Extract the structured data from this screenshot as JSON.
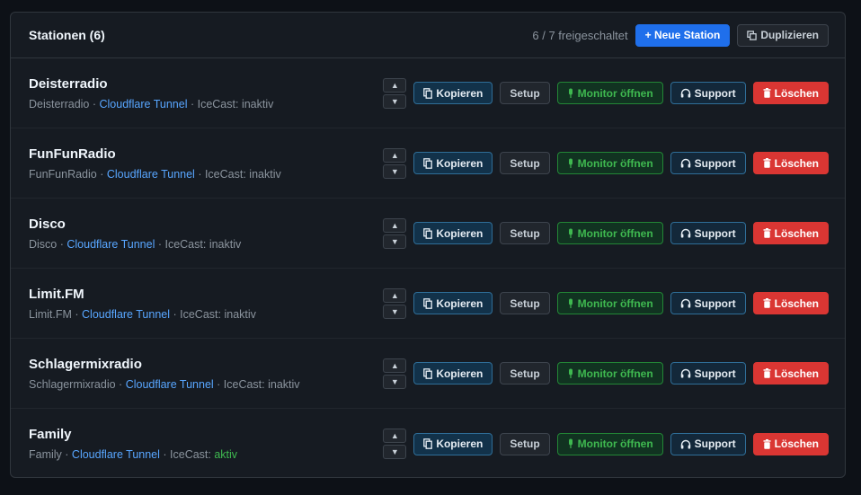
{
  "header": {
    "title": "Stationen (6)",
    "unlock_info": "6 / 7 freigeschaltet",
    "new_station_label": "+ Neue Station",
    "duplicate_label": "Duplizieren"
  },
  "row_actions": {
    "copy_label": "Kopieren",
    "setup_label": "Setup",
    "monitor_label": "Monitor öffnen",
    "support_label": "Support",
    "delete_label": "Löschen"
  },
  "icons": {
    "move_up": "triangle-up-icon",
    "move_down": "triangle-down-icon",
    "copy": "copy-icon",
    "monitor": "mic-icon",
    "support": "headphones-icon",
    "delete": "trash-icon",
    "duplicate": "duplicate-icon"
  },
  "colors": {
    "primary": "#1f6feb",
    "link": "#58a6ff",
    "success": "#3fb950",
    "danger": "#da3633"
  },
  "stations": [
    {
      "name": "Deisterradio",
      "subtitle": "Deisterradio",
      "tunnel": "Cloudflare Tunnel",
      "icecast_label": "IceCast:",
      "icecast_status": "inaktiv",
      "icecast_active": false
    },
    {
      "name": "FunFunRadio",
      "subtitle": "FunFunRadio",
      "tunnel": "Cloudflare Tunnel",
      "icecast_label": "IceCast:",
      "icecast_status": "inaktiv",
      "icecast_active": false
    },
    {
      "name": "Disco",
      "subtitle": "Disco",
      "tunnel": "Cloudflare Tunnel",
      "icecast_label": "IceCast:",
      "icecast_status": "inaktiv",
      "icecast_active": false
    },
    {
      "name": "Limit.FM",
      "subtitle": "Limit.FM",
      "tunnel": "Cloudflare Tunnel",
      "icecast_label": "IceCast:",
      "icecast_status": "inaktiv",
      "icecast_active": false
    },
    {
      "name": "Schlagermixradio",
      "subtitle": "Schlagermixradio",
      "tunnel": "Cloudflare Tunnel",
      "icecast_label": "IceCast:",
      "icecast_status": "inaktiv",
      "icecast_active": false
    },
    {
      "name": "Family",
      "subtitle": "Family",
      "tunnel": "Cloudflare Tunnel",
      "icecast_label": "IceCast:",
      "icecast_status": "aktiv",
      "icecast_active": true
    }
  ]
}
